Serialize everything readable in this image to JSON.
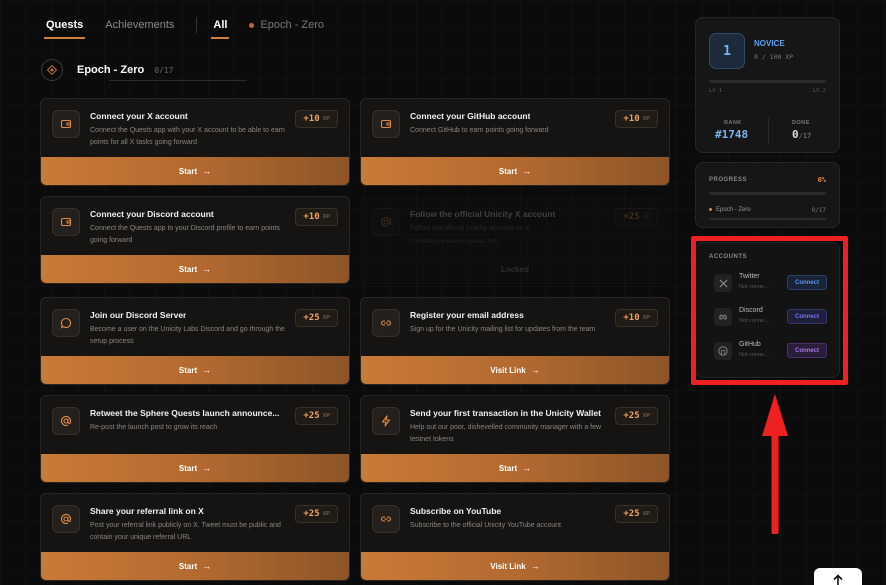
{
  "nav": {
    "tabs": [
      "Quests",
      "Achievements"
    ],
    "filters": [
      "All",
      "Epoch - Zero"
    ]
  },
  "section": {
    "title": "Epoch - Zero",
    "count": "0/17"
  },
  "quests": [
    {
      "title": "Connect your X account",
      "desc": "Connect the Quests app with your X account to be able to earn points for all X tasks going forward",
      "xp": "+10",
      "xp_unit": "XP",
      "button": "Start",
      "icon": "wallet-icon"
    },
    {
      "title": "Connect your GitHub account",
      "desc": "Connect GitHub to earn points going forward",
      "xp": "+10",
      "xp_unit": "XP",
      "button": "Start",
      "icon": "wallet-icon"
    },
    {
      "title": "Connect your Discord account",
      "desc": "Connect the Quests app to your Discord profile to earn points going forward",
      "xp": "+10",
      "xp_unit": "XP",
      "button": "Start",
      "icon": "wallet-icon"
    },
    {
      "title": "Follow the official Unicity X account",
      "desc": "Follow our official Unicity account on X",
      "extra": "Complete connection quests first",
      "xp": "+25",
      "xp_unit": "XP",
      "button": "Locked",
      "icon": "at-icon"
    },
    {
      "title": "Join our Discord Server",
      "desc": "Become a user on the Unicity Labs Discord and go through the setup process",
      "xp": "+25",
      "xp_unit": "XP",
      "button": "Start",
      "icon": "chat-icon"
    },
    {
      "title": "Register your email address",
      "desc": "Sign up for the Unicity mailing list for updates from the team",
      "xp": "+10",
      "xp_unit": "XP",
      "button": "Visit Link",
      "icon": "link-icon"
    },
    {
      "title": "Retweet the Sphere Quests launch announce...",
      "desc": "Re-post the launch post to grow its reach",
      "xp": "+25",
      "xp_unit": "XP",
      "button": "Start",
      "icon": "at-icon"
    },
    {
      "title": "Send your first transaction in the Unicity Wallet",
      "desc": "Help out our poor, dishevelled community manager with a few testnet tokens",
      "xp": "+25",
      "xp_unit": "XP",
      "button": "Start",
      "icon": "bolt-icon"
    },
    {
      "title": "Share your referral link on X",
      "desc": "Post your referral link publicly on X. Tweet must be public and contain your unique referral URL",
      "xp": "+25",
      "xp_unit": "XP",
      "button": "Start",
      "icon": "at-icon"
    },
    {
      "title": "Subscribe on YouTube",
      "desc": "Subscribe to the official Unicity YouTube account",
      "xp": "+25",
      "xp_unit": "XP",
      "button": "Visit Link",
      "icon": "link-icon"
    }
  ],
  "profile": {
    "level": "1",
    "rank_title": "NOVICE",
    "xp": "0 / 100 XP",
    "xp_fraction": 0,
    "lv_from": "LV 1",
    "lv_to": "LV 2",
    "rank_label": "RANK",
    "rank_value": "#1748",
    "done_label": "DONE",
    "done_value": "0",
    "done_total": "/17"
  },
  "progress": {
    "label": "PROGRESS",
    "percent": "0%",
    "items": [
      {
        "name": "Epoch - Zero",
        "count": "0/17",
        "fraction": 0
      }
    ]
  },
  "accounts": {
    "label": "ACCOUNTS",
    "items": [
      {
        "name": "Twitter",
        "status": "Not conne...",
        "button": "Connect",
        "icon": "x-logo-icon",
        "color": "#3b82f6"
      },
      {
        "name": "Discord",
        "status": "Not conne...",
        "button": "Connect",
        "icon": "discord-icon",
        "color": "#6366f1"
      },
      {
        "name": "GitHub",
        "status": "Not conne...",
        "button": "Connect",
        "icon": "github-icon",
        "color": "#a855f7"
      }
    ]
  },
  "colors": {
    "accent": "#d27f3a",
    "highlight": "#ee2020",
    "level_blue": "#5aa6f0"
  }
}
